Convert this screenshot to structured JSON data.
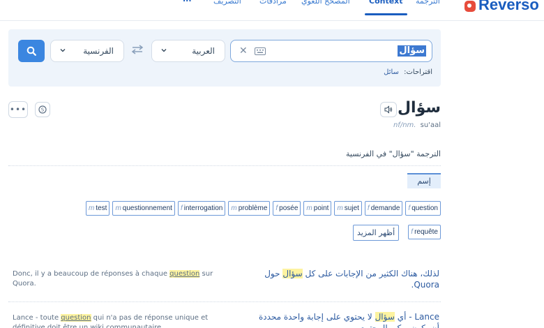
{
  "nav": {
    "items": [
      "...",
      "التصريف",
      "مرادفات",
      "المصحح اللغوي",
      "Context",
      "الترجمة"
    ],
    "active": "Context",
    "brand": "Reverso",
    "brand_color": "#1a5dbf",
    "accent_color": "#3b86e0"
  },
  "search": {
    "query": "سؤال",
    "source_lang": "العربية",
    "target_lang": "الفرنسية",
    "suggestions_label": "اقتراحات:",
    "suggestions": [
      "سائل"
    ],
    "icons": [
      "search-icon",
      "swap-icon",
      "keyboard-icon",
      "clear-icon",
      "chevron-down-icon"
    ]
  },
  "entry": {
    "headword": "سؤال",
    "pos": "nf/nm.",
    "transliteration": "su'aal",
    "translate_heading": "الترجمة \"سؤال\" في الفرنسية",
    "pos_tab": "إسم",
    "show_more": "أظهر المزيد",
    "translations_row1": [
      {
        "g": "f",
        "w": "question"
      },
      {
        "g": "f",
        "w": "demande"
      },
      {
        "g": "m",
        "w": "sujet"
      },
      {
        "g": "m",
        "w": "point"
      },
      {
        "g": "f",
        "w": "posée"
      },
      {
        "g": "m",
        "w": "problème"
      },
      {
        "g": "f",
        "w": "interrogation"
      },
      {
        "g": "m",
        "w": "questionnement"
      },
      {
        "g": "m",
        "w": "test"
      }
    ],
    "translations_row2": [
      {
        "g": "f",
        "w": "requête"
      }
    ]
  },
  "examples": [
    {
      "src_before": "Donc, il y a beaucoup de réponses à chaque ",
      "src_hl": "question",
      "src_after": " sur Quora.",
      "tgt_before": "لذلك، هناك الكثير من الإجابات على كل ",
      "tgt_hl": "سؤال",
      "tgt_after": " حول Quora."
    },
    {
      "src_before": "Lance - toute ",
      "src_hl": "question",
      "src_after": " qui n'a pas de réponse unique et définitive doit être un wiki communautaire.",
      "tgt_before": "Lance - أي ",
      "tgt_hl": "سؤال",
      "tgt_after": " لا يحتوي على إجابة واحدة محددة أن يكون ويكي المجتمع"
    }
  ]
}
